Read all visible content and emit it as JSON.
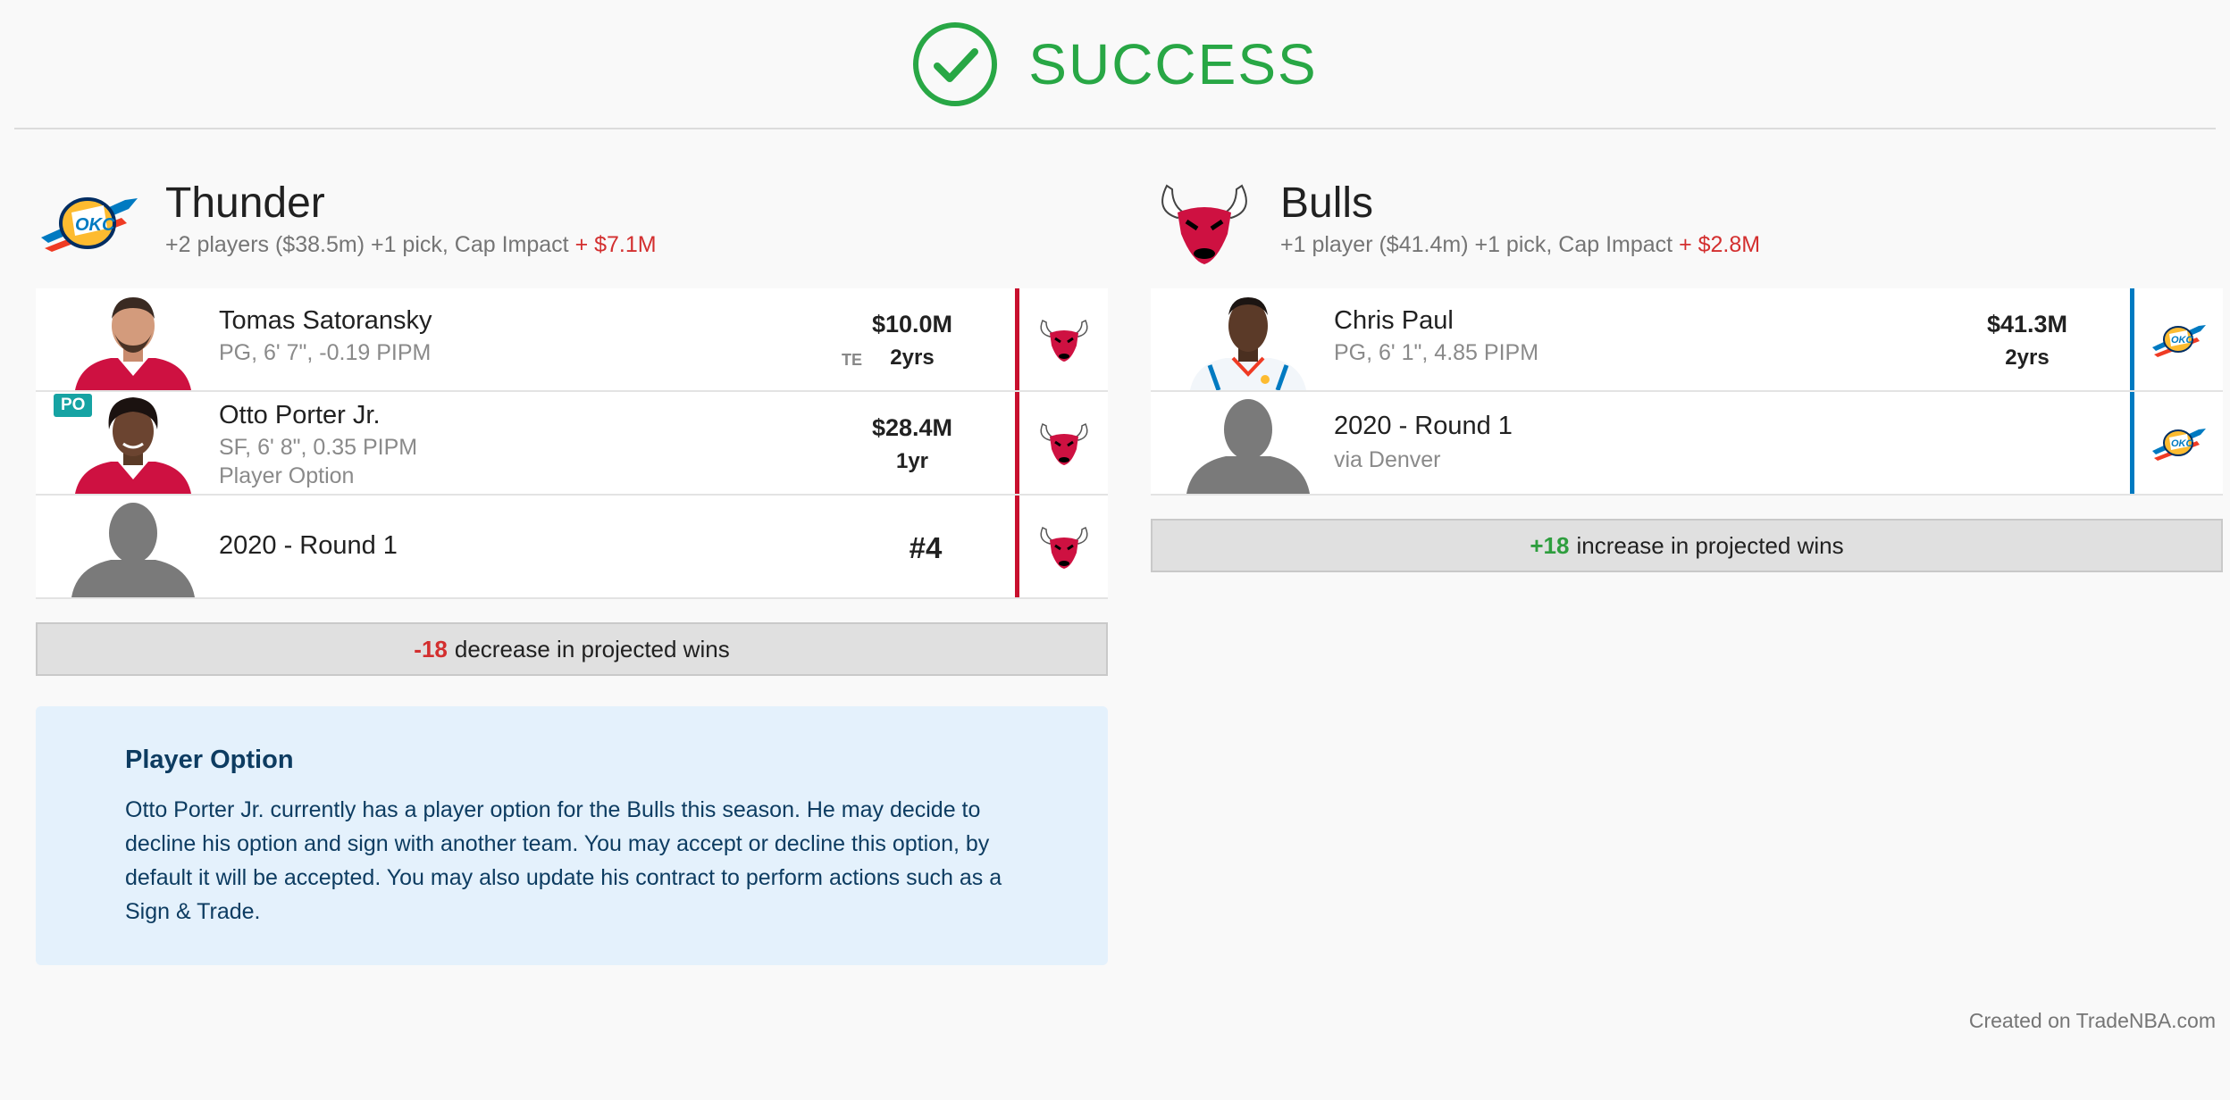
{
  "header": {
    "status": "SUCCESS"
  },
  "left": {
    "team": "Thunder",
    "summary": "+2 players ($38.5m) +1 pick, Cap Impact",
    "cap_impact": "+ $7.1M",
    "players": [
      {
        "name": "Tomas Satoransky",
        "details": "PG, 6' 7\", -0.19 PIPM",
        "salary": "$10.0M",
        "years": "2yrs",
        "tag": "TE"
      },
      {
        "name": "Otto Porter Jr.",
        "details": "SF, 6' 8\", 0.35 PIPM",
        "extra": "Player Option",
        "badge": "PO",
        "salary": "$28.4M",
        "years": "1yr"
      }
    ],
    "pick": {
      "name": "2020 - Round 1",
      "number": "#4"
    },
    "wins": {
      "value": "-18",
      "text": "decrease in projected wins"
    },
    "note": {
      "title": "Player Option",
      "body": "Otto Porter Jr. currently has a player option for the Bulls this season. He may decide to decline his option and sign with another team. You may accept or decline this option, by default it will be accepted. You may also update his contract to perform actions such as a Sign & Trade."
    }
  },
  "right": {
    "team": "Bulls",
    "summary": "+1 player ($41.4m) +1 pick, Cap Impact",
    "cap_impact": "+ $2.8M",
    "players": [
      {
        "name": "Chris Paul",
        "details": "PG, 6' 1\", 4.85 PIPM",
        "salary": "$41.3M",
        "years": "2yrs"
      }
    ],
    "pick": {
      "name": "2020 - Round 1",
      "via": "via Denver"
    },
    "wins": {
      "value": "+18",
      "text": "increase in projected wins"
    }
  },
  "footer": "Created on TradeNBA.com",
  "colors": {
    "success": "#28a745",
    "bulls": "#c8102e",
    "thunder": "#007ac1",
    "negative": "#d32f2f",
    "positive": "#2e9e3e"
  }
}
